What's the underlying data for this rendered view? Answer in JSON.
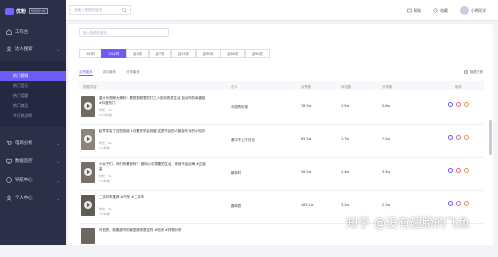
{
  "brand": {
    "name": "优粉",
    "tag": "短视频分析"
  },
  "topbar": {
    "search_placeholder": "请输入视频关键词",
    "items": [
      {
        "label": "帮助"
      },
      {
        "label": "收藏"
      }
    ],
    "user": "小明同学"
  },
  "sidebar": {
    "items": [
      {
        "label": "工作台",
        "icon": "home-icon"
      },
      {
        "label": "达人搜索",
        "icon": "user-icon"
      },
      {
        "label": "热点分析",
        "icon": "fire-icon"
      }
    ],
    "sub_items": [
      {
        "label": "热门视频",
        "active": true
      },
      {
        "label": "热门音乐",
        "active": false
      },
      {
        "label": "热门话题",
        "active": false
      },
      {
        "label": "热门商品",
        "active": false
      },
      {
        "label": "今日热点榜",
        "active": false
      },
      {
        "label": "热门挑战",
        "active": false
      }
    ],
    "items2": [
      {
        "label": "电商分析",
        "icon": "cart-icon"
      },
      {
        "label": "数据监控",
        "icon": "monitor-icon"
      },
      {
        "label": "导航中心",
        "icon": "compass-icon"
      },
      {
        "label": "个人中心",
        "icon": "person-icon"
      }
    ]
  },
  "main": {
    "search_placeholder": "输入视频关键词",
    "time_tabs": [
      "1小时",
      "24小时",
      "近3天",
      "近7天",
      "近15天",
      "近30天",
      "近60天",
      "近90天"
    ],
    "active_tab": 1,
    "sub_tabs": [
      "点赞最多",
      "评论最多",
      "分享最多"
    ],
    "toggle_label": "隐藏已看",
    "columns": [
      "视频内容",
      "达人",
      "点赞数",
      "评论数",
      "分享数",
      "操作"
    ],
    "rows": [
      {
        "title": "重大乐视频大爆料！看短视频里的打工人如何改变生活 加点你的幸福感 #抖音热门",
        "meta1": "时长：1s",
        "meta2": "12小时前",
        "author": "中国青年报",
        "likes": "78.5w",
        "comments": "2.5w",
        "shares": "5.6w"
      },
      {
        "title": "趁早学会了这些技能 1月看完学会到腿 这是不会的人都会吃亏的小知识",
        "meta1": "时长：2s",
        "meta2": "1小时前",
        "author": "看中不上厅在也",
        "likes": "65.2w",
        "comments": "1.7w",
        "shares": "7.2w"
      },
      {
        "title": "小伙子们，你们有看到吗？ 做你心中想要的生活，你就不会后悔 #正能量",
        "meta1": "时长：1s",
        "meta2": "7小时前",
        "author": "解析时",
        "likes": "56.5w",
        "comments": "2.4w",
        "shares": "3.5w"
      },
      {
        "title": "二手好车推荐 #汽车 #二手车",
        "meta1": "时长：2s",
        "meta2": "7小时前",
        "author": "圆球君",
        "likes": "185.1w",
        "comments": "3.2w",
        "shares": "2.2w"
      },
      {
        "title": "可怕的，制服超市的秘密原来是这样 #知识 #好物分享",
        "meta1": "",
        "meta2": "",
        "author": "",
        "likes": "",
        "comments": "",
        "shares": ""
      }
    ]
  },
  "watermark": "知乎 @没有翅膀的飞鱼",
  "colors": {
    "accent": "#6a5cf5",
    "sidebar": "#2b2f47"
  }
}
